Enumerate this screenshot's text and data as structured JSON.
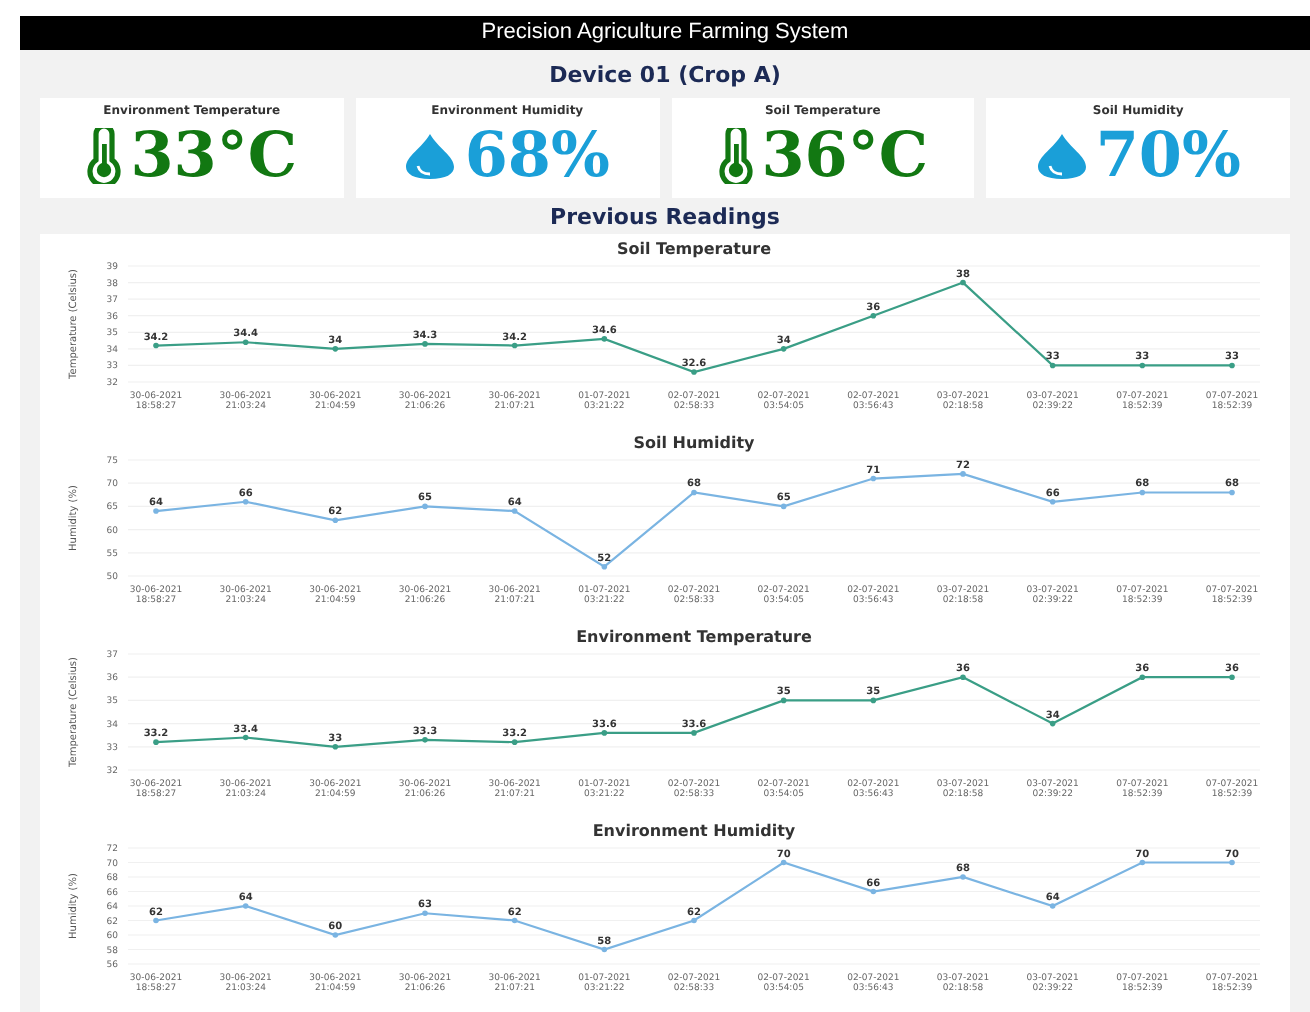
{
  "header": {
    "title": "Precision Agriculture Farming System"
  },
  "device": {
    "title": "Device 01 (Crop A)"
  },
  "cards": [
    {
      "label": "Environment Temperature",
      "value": "33°C",
      "kind": "temperature"
    },
    {
      "label": "Environment Humidity",
      "value": "68%",
      "kind": "humidity"
    },
    {
      "label": "Soil Temperature",
      "value": "36°C",
      "kind": "temperature"
    },
    {
      "label": "Soil Humidity",
      "value": "70%",
      "kind": "humidity"
    }
  ],
  "history": {
    "title": "Previous Readings",
    "charts": [
      {
        "chart_data": {
          "type": "line",
          "title": "Soil Temperature",
          "ylabel": "Temperature (Celsius)",
          "categories": [
            "30-06-2021 18:58:27",
            "30-06-2021 21:03:24",
            "30-06-2021 21:04:59",
            "30-06-2021 21:06:26",
            "30-06-2021 21:07:21",
            "01-07-2021 03:21:22",
            "02-07-2021 02:58:33",
            "02-07-2021 03:54:05",
            "02-07-2021 03:56:43",
            "03-07-2021 02:18:58",
            "03-07-2021 02:39:22",
            "07-07-2021 18:52:39",
            "07-07-2021 18:52:39"
          ],
          "grid": true,
          "series": [
            {
              "color": "#3a9e86",
              "values": [
                34.2,
                34.4,
                34,
                34.3,
                34.2,
                34.6,
                32.6,
                34,
                36,
                38,
                33,
                33,
                33
              ]
            }
          ],
          "ylim": [
            32,
            39
          ],
          "yticks": [
            32,
            33,
            34,
            35,
            36,
            37,
            38,
            39
          ],
          "data_labels": true
        }
      },
      {
        "chart_data": {
          "type": "line",
          "title": "Soil Humidity",
          "ylabel": "Humidity (%)",
          "categories": [
            "30-06-2021 18:58:27",
            "30-06-2021 21:03:24",
            "30-06-2021 21:04:59",
            "30-06-2021 21:06:26",
            "30-06-2021 21:07:21",
            "01-07-2021 03:21:22",
            "02-07-2021 02:58:33",
            "02-07-2021 03:54:05",
            "02-07-2021 03:56:43",
            "03-07-2021 02:18:58",
            "03-07-2021 02:39:22",
            "07-07-2021 18:52:39",
            "07-07-2021 18:52:39"
          ],
          "grid": true,
          "series": [
            {
              "color": "#7ab4e2",
              "values": [
                64,
                66,
                62,
                65,
                64,
                52,
                68,
                65,
                71,
                72,
                66,
                68,
                68
              ]
            }
          ],
          "ylim": [
            50,
            75
          ],
          "yticks": [
            50,
            55,
            60,
            65,
            70,
            75
          ],
          "data_labels": true
        }
      },
      {
        "chart_data": {
          "type": "line",
          "title": "Environment Temperature",
          "ylabel": "Temperature (Celsius)",
          "categories": [
            "30-06-2021 18:58:27",
            "30-06-2021 21:03:24",
            "30-06-2021 21:04:59",
            "30-06-2021 21:06:26",
            "30-06-2021 21:07:21",
            "01-07-2021 03:21:22",
            "02-07-2021 02:58:33",
            "02-07-2021 03:54:05",
            "02-07-2021 03:56:43",
            "03-07-2021 02:18:58",
            "03-07-2021 02:39:22",
            "07-07-2021 18:52:39",
            "07-07-2021 18:52:39"
          ],
          "grid": true,
          "series": [
            {
              "color": "#3a9e86",
              "values": [
                33.2,
                33.4,
                33,
                33.3,
                33.2,
                33.6,
                33.6,
                35,
                35,
                36,
                34,
                36,
                36
              ]
            }
          ],
          "ylim": [
            32,
            37
          ],
          "yticks": [
            32,
            33,
            34,
            35,
            36,
            37
          ],
          "data_labels": true
        }
      },
      {
        "chart_data": {
          "type": "line",
          "title": "Environment Humidity",
          "ylabel": "Humidity (%)",
          "categories": [
            "30-06-2021 18:58:27",
            "30-06-2021 21:03:24",
            "30-06-2021 21:04:59",
            "30-06-2021 21:06:26",
            "30-06-2021 21:07:21",
            "01-07-2021 03:21:22",
            "02-07-2021 02:58:33",
            "02-07-2021 03:54:05",
            "02-07-2021 03:56:43",
            "03-07-2021 02:18:58",
            "03-07-2021 02:39:22",
            "07-07-2021 18:52:39",
            "07-07-2021 18:52:39"
          ],
          "grid": true,
          "series": [
            {
              "color": "#7ab4e2",
              "values": [
                62,
                64,
                60,
                63,
                62,
                58,
                62,
                70,
                66,
                68,
                64,
                70,
                70
              ]
            }
          ],
          "ylim": [
            56,
            72
          ],
          "yticks": [
            56,
            58,
            60,
            62,
            64,
            66,
            68,
            70,
            72
          ],
          "data_labels": true
        }
      }
    ]
  }
}
